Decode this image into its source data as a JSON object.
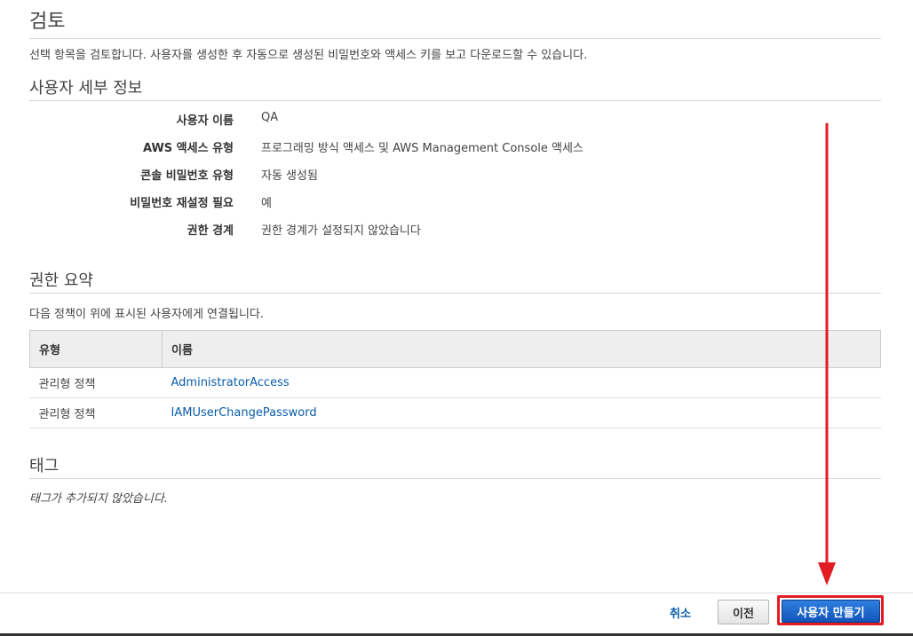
{
  "page": {
    "title": "검토",
    "description": "선택 항목을 검토합니다. 사용자를 생성한 후 자동으로 생성된 비밀번호와 액세스 키를 보고 다운로드할 수 있습니다."
  },
  "user_details": {
    "heading": "사용자 세부 정보",
    "rows": [
      {
        "label": "사용자 이름",
        "value": "QA"
      },
      {
        "label": "AWS 액세스 유형",
        "value": "프로그래밍 방식 액세스 및 AWS Management Console 액세스"
      },
      {
        "label": "콘솔 비밀번호 유형",
        "value": "자동 생성됨"
      },
      {
        "label": "비밀번호 재설정 필요",
        "value": "예"
      },
      {
        "label": "권한 경계",
        "value": "권한 경계가 설정되지 않았습니다"
      }
    ]
  },
  "permissions": {
    "heading": "권한 요약",
    "description": "다음 정책이 위에 표시된 사용자에게 연결됩니다.",
    "columns": [
      "유형",
      "이름"
    ],
    "rows": [
      {
        "type": "관리형 정책",
        "name": "AdministratorAccess"
      },
      {
        "type": "관리형 정책",
        "name": "IAMUserChangePassword"
      }
    ]
  },
  "tags": {
    "heading": "태그",
    "empty_text": "태그가 추가되지 않았습니다."
  },
  "footer": {
    "cancel_label": "취소",
    "previous_label": "이전",
    "create_label": "사용자 만들기"
  },
  "colors": {
    "link": "#0a5da8",
    "primary_button": "#1e66cc",
    "highlight": "#e31b23"
  }
}
